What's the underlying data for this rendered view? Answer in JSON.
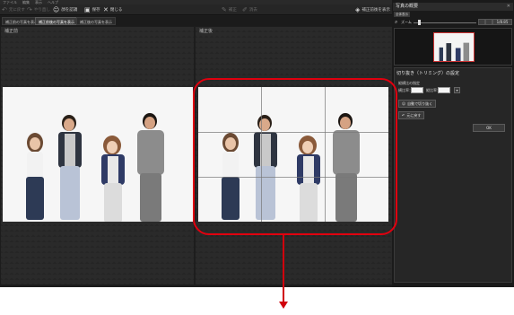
{
  "menubar": {
    "items": [
      "ファイル",
      "編集",
      "表示",
      "ヘルプ"
    ]
  },
  "toolbar": {
    "undo_label": "元に戻す",
    "redo_label": "やり直し",
    "face_label": "顔を認識",
    "save_label": "保存",
    "close_label": "閉じる",
    "tool1_label": "補正",
    "tool2_label": "消去",
    "compare_label": "補正前後を表示"
  },
  "tabs": [
    {
      "label": "補正前の写真を表示"
    },
    {
      "label": "補正前後の写真を表示"
    },
    {
      "label": "補正後の写真を表示"
    }
  ],
  "panels": {
    "before_label": "補正前",
    "after_label": "補正後"
  },
  "navigator": {
    "title": "写真の概要",
    "mini_tab": "全体表示",
    "zoom_label": "ズーム",
    "zoom_value": "1/8.85"
  },
  "dialog": {
    "title": "切り抜き（トリミング）の設定",
    "subtitle": "縦横比の指定",
    "width_label": "横比率：",
    "height_label": "縦比率：",
    "auto_button": "自動で切り抜く",
    "redo_button": "元に戻す",
    "ok_button": "OK"
  },
  "colors": {
    "highlight": "#e0000f",
    "background": "#1d1d1d"
  }
}
